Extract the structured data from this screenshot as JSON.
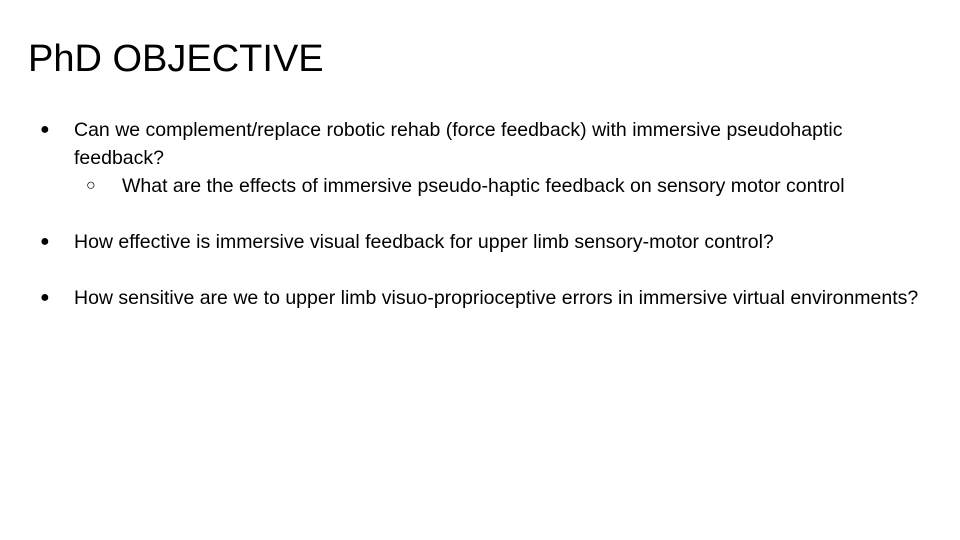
{
  "slide": {
    "title": "PhD OBJECTIVE",
    "bullet_glyph": "●",
    "sub_bullet_glyph": "○",
    "items": [
      {
        "text": "Can we complement/replace robotic rehab (force feedback) with immersive pseudohaptic feedback?",
        "sub_items": [
          "What are the effects of immersive pseudo-haptic feedback on sensory motor control"
        ]
      },
      {
        "text": "How effective is immersive visual feedback for upper limb sensory-motor control?"
      },
      {
        "text": "How sensitive are we to upper limb visuo-proprioceptive errors in immersive virtual environments?"
      }
    ]
  }
}
